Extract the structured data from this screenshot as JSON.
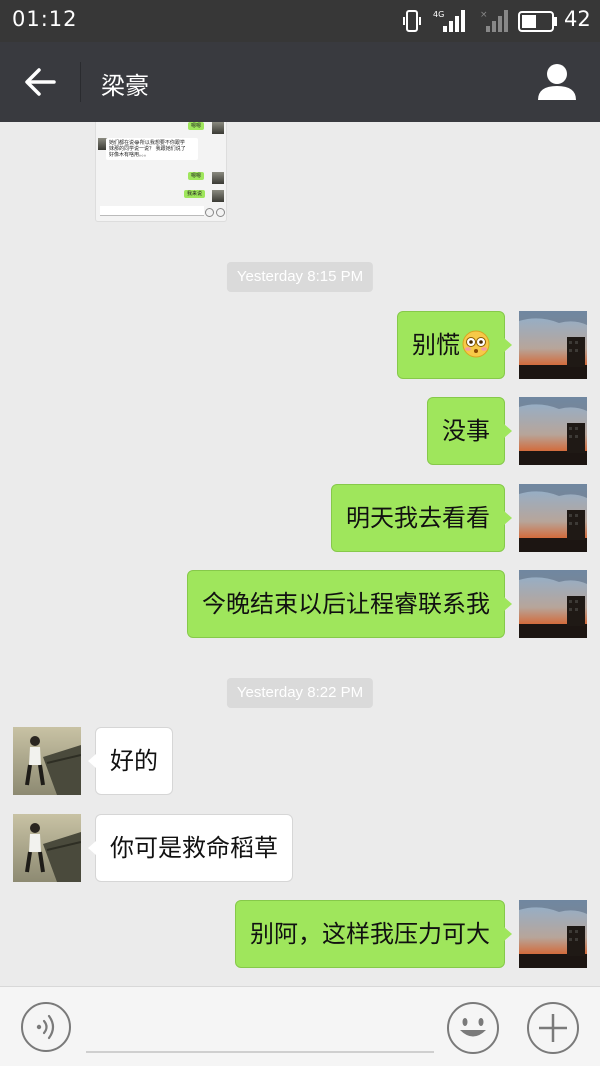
{
  "status_bar": {
    "time": "01:12",
    "network_label": "4G",
    "battery_level": "42"
  },
  "header": {
    "title": "梁豪"
  },
  "screenshot_preview": {
    "lines": [
      "嗯嗯",
      "她们都在说😂所以我想要不你跟学",
      "妹那的同学说一说？ 我跟她们说了",
      "好像木有啥用。。。",
      "嗯嗯",
      "我来说"
    ]
  },
  "messages": [
    {
      "type": "timestamp",
      "text": "Yesterday 8:15 PM"
    },
    {
      "type": "sent",
      "text": "别慌",
      "emoji": "flushed-face-icon"
    },
    {
      "type": "sent",
      "text": "没事"
    },
    {
      "type": "sent",
      "text": "明天我去看看"
    },
    {
      "type": "sent",
      "text": "今晚结束以后让程睿联系我"
    },
    {
      "type": "timestamp",
      "text": "Yesterday 8:22 PM"
    },
    {
      "type": "received",
      "text": "好的"
    },
    {
      "type": "received",
      "text": "你可是救命稻草"
    },
    {
      "type": "sent",
      "text": "别阿，这样我压力可大"
    }
  ],
  "input_bar": {
    "value": "",
    "placeholder": ""
  },
  "colors": {
    "status_bar_bg": "#373737",
    "header_bg": "#393a3f",
    "chat_bg": "#ebebeb",
    "sent_bubble": "#9fe65c",
    "received_bubble": "#ffffff",
    "timestamp_bg": "#dadada"
  },
  "icons": {
    "back": "arrow-left-icon",
    "profile": "person-icon",
    "voice": "voice-icon",
    "emoji": "smiley-icon",
    "more": "plus-icon"
  }
}
